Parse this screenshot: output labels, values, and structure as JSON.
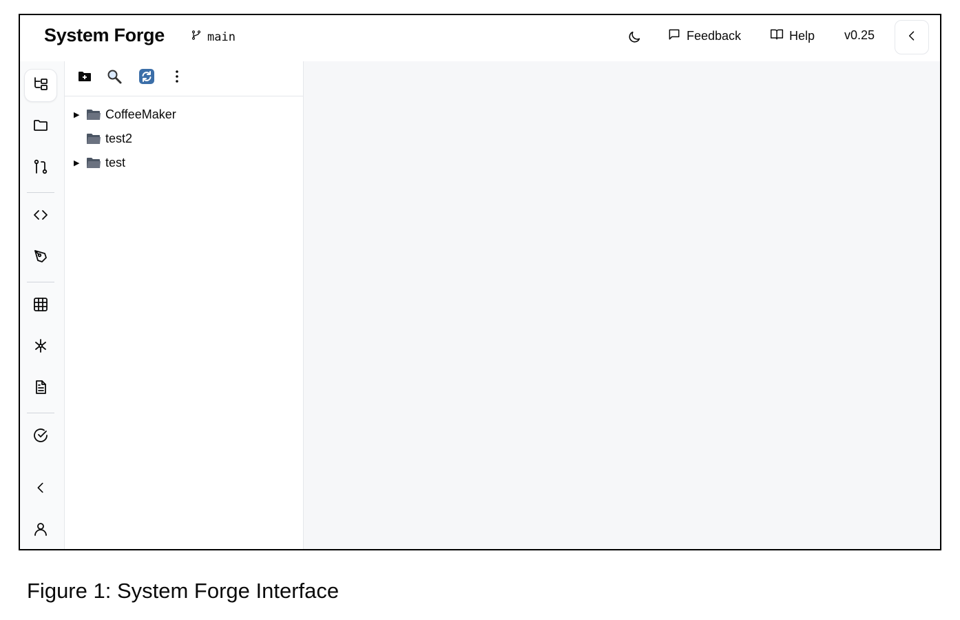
{
  "header": {
    "title": "System Forge",
    "branch": "main",
    "theme_icon": "moon-icon",
    "feedback_label": "Feedback",
    "help_label": "Help",
    "version": "v0.25"
  },
  "rail": {
    "items": [
      {
        "icon": "tree-view-icon",
        "active": true
      },
      {
        "icon": "folder-icon"
      },
      {
        "icon": "git-pull-request-icon"
      },
      {
        "icon": "code-icon"
      },
      {
        "icon": "pen-tool-icon"
      },
      {
        "icon": "table-icon"
      },
      {
        "icon": "network-icon"
      },
      {
        "icon": "document-icon"
      },
      {
        "icon": "check-circle-icon"
      },
      {
        "icon": "chevron-left-icon"
      },
      {
        "icon": "user-icon"
      }
    ]
  },
  "explorer": {
    "toolbar": [
      "new-folder-icon",
      "search-icon",
      "refresh-icon",
      "more-vertical-icon"
    ],
    "tree": [
      {
        "label": "CoffeeMaker",
        "expandable": true
      },
      {
        "label": "test2",
        "expandable": false
      },
      {
        "label": "test",
        "expandable": true
      }
    ]
  },
  "caption": "Figure 1: System Forge Interface",
  "colors": {
    "panel_bg": "#f9fafb",
    "content_bg": "#f6f7f9",
    "refresh_icon": "#3b6ea8"
  }
}
